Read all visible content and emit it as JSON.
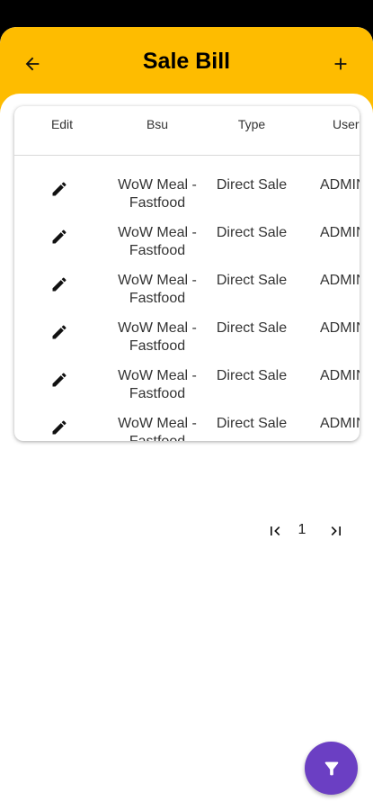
{
  "header": {
    "title": "Sale Bill",
    "back_icon": "arrow-left-icon",
    "add_icon": "plus-icon"
  },
  "table": {
    "columns": [
      "Edit",
      "Bsu",
      "Type",
      "User"
    ],
    "rows": [
      {
        "bsu": "WoW Meal - Fastfood",
        "type": "Direct Sale",
        "user": "ADMIN"
      },
      {
        "bsu": "WoW Meal - Fastfood",
        "type": "Direct Sale",
        "user": "ADMIN"
      },
      {
        "bsu": "WoW Meal - Fastfood",
        "type": "Direct Sale",
        "user": "ADMIN"
      },
      {
        "bsu": "WoW Meal - Fastfood",
        "type": "Direct Sale",
        "user": "ADMIN"
      },
      {
        "bsu": "WoW Meal - Fastfood",
        "type": "Direct Sale",
        "user": "ADMIN"
      },
      {
        "bsu": "WoW Meal - Fastfood",
        "type": "Direct Sale",
        "user": "ADMIN"
      }
    ],
    "edit_icon": "pencil-icon"
  },
  "pagination": {
    "page": "1",
    "first_icon": "first-page-icon",
    "last_icon": "last-page-icon"
  },
  "fab": {
    "icon": "filter-icon",
    "color": "#6B3FC3"
  },
  "colors": {
    "accent": "#FEBC00"
  }
}
